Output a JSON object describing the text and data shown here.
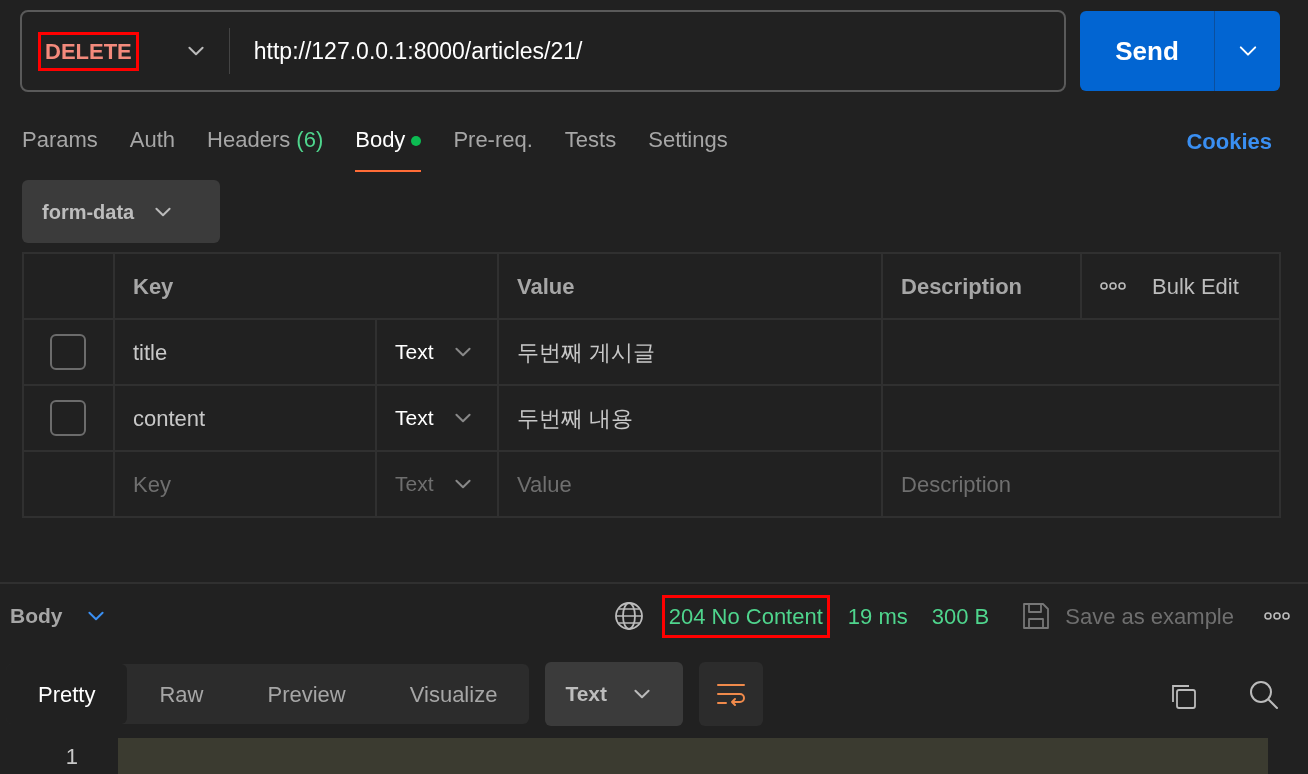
{
  "request": {
    "method": {
      "text": "DELETE",
      "highlighted": true
    },
    "url": "http://127.0.0.1:8000/articles/21/",
    "send_label": "Send"
  },
  "tabs": [
    {
      "label": "Params",
      "selected": false
    },
    {
      "label": "Auth",
      "selected": false
    },
    {
      "label": "Headers",
      "count": "(6)",
      "selected": false
    },
    {
      "label": "Body",
      "selected": true,
      "dot": true
    },
    {
      "label": "Pre-req.",
      "selected": false
    },
    {
      "label": "Tests",
      "selected": false
    },
    {
      "label": "Settings",
      "selected": false
    }
  ],
  "cookies": "Cookies",
  "body_mode": "form-data",
  "table": {
    "columns": [
      "Key",
      "Value",
      "Description"
    ],
    "bulk_edit": "Bulk Edit",
    "rows": [
      {
        "checked": false,
        "key": "title",
        "type": "Text",
        "value": "두번째 게시글"
      },
      {
        "checked": false,
        "key": "content",
        "type": "Text",
        "value": "두번째 내용"
      }
    ],
    "new_row": {
      "key_placeholder": "Key",
      "type": "Text",
      "value_placeholder": "Value",
      "description_placeholder": "Description"
    }
  },
  "response": {
    "section": "Body",
    "status": {
      "text": "204 No Content",
      "highlighted": true
    },
    "time": "19 ms",
    "size": "300 B",
    "save": "Save as example",
    "view_tabs": [
      {
        "label": "Pretty",
        "selected": true
      },
      {
        "label": "Raw",
        "selected": false
      },
      {
        "label": "Preview",
        "selected": false
      },
      {
        "label": "Visualize",
        "selected": false
      }
    ],
    "format": "Text",
    "line_numbers": [
      "1"
    ]
  }
}
